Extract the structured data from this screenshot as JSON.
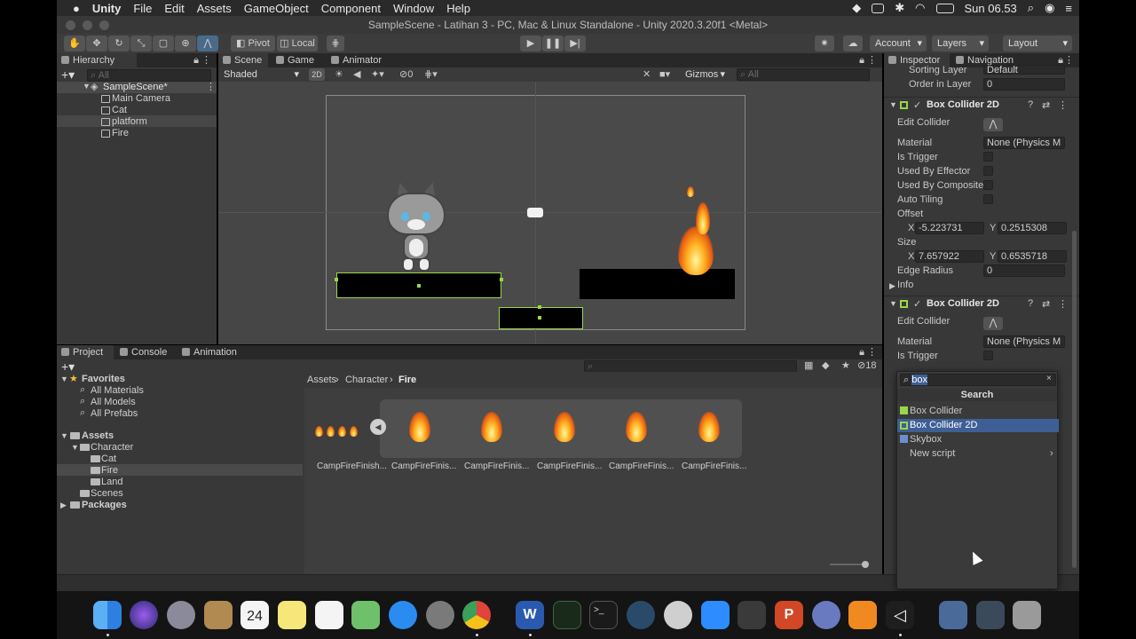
{
  "menubar": {
    "app": "Unity",
    "items": [
      "File",
      "Edit",
      "Assets",
      "GameObject",
      "Component",
      "Window",
      "Help"
    ],
    "clock": "Sun 06.53"
  },
  "window": {
    "title": "SampleScene - Latihan 3 - PC, Mac & Linux Standalone - Unity 2020.3.20f1 <Metal>"
  },
  "toolbar": {
    "pivot": "Pivot",
    "local": "Local",
    "account": "Account",
    "layers": "Layers",
    "layout": "Layout"
  },
  "hierarchy": {
    "tab": "Hierarchy",
    "search_placeholder": "All",
    "scene": "SampleScene*",
    "objects": [
      "Main Camera",
      "Cat",
      "platform",
      "Fire"
    ]
  },
  "scene_view": {
    "tabs": [
      "Scene",
      "Game",
      "Animator"
    ],
    "shading": "Shaded",
    "mode_2d": "2D",
    "hidden_count": "0",
    "gizmos": "Gizmos",
    "search_placeholder": "All"
  },
  "project": {
    "tabs": [
      "Project",
      "Console",
      "Animation"
    ],
    "favorites_label": "Favorites",
    "favorites": [
      "All Materials",
      "All Models",
      "All Prefabs"
    ],
    "assets_label": "Assets",
    "character_label": "Character",
    "character_children": [
      "Cat",
      "Fire",
      "Land"
    ],
    "scenes": "Scenes",
    "packages": "Packages",
    "breadcrumb": [
      "Assets",
      "Character",
      "Fire"
    ],
    "hidden_count": "18",
    "files": [
      "CampFireFinish...",
      "CampFireFinis...",
      "CampFireFinis...",
      "CampFireFinis...",
      "CampFireFinis...",
      "CampFireFinis..."
    ]
  },
  "inspector": {
    "tabs": [
      "Inspector",
      "Navigation"
    ],
    "sorting_layer_label": "Sorting Layer",
    "sorting_layer_value": "Default",
    "order_label": "Order in Layer",
    "order_value": "0",
    "collider1": {
      "title": "Box Collider 2D",
      "edit_collider": "Edit Collider",
      "material_label": "Material",
      "material_value": "None (Physics M",
      "is_trigger": "Is Trigger",
      "used_by_effector": "Used By Effector",
      "used_by_composite": "Used By Composite",
      "auto_tiling": "Auto Tiling",
      "offset_label": "Offset",
      "offset_x": "-5.223731",
      "offset_y": "0.2515308",
      "size_label": "Size",
      "size_x": "7.657922",
      "size_y": "0.6535718",
      "edge_radius_label": "Edge Radius",
      "edge_radius_value": "0",
      "info": "Info",
      "x": "X",
      "y": "Y"
    },
    "collider2": {
      "title": "Box Collider 2D",
      "edit_collider": "Edit Collider",
      "material_label": "Material",
      "material_value": "None (Physics M",
      "is_trigger": "Is Trigger"
    }
  },
  "add_component_popup": {
    "search_value": "box",
    "header": "Search",
    "results": [
      "Box Collider",
      "Box Collider 2D",
      "Skybox",
      "New script"
    ],
    "selected_index": 1
  },
  "colors": {
    "accent_selection": "#3e5f96",
    "collider_green": "#9ad64a",
    "panel_bg": "#383838"
  }
}
